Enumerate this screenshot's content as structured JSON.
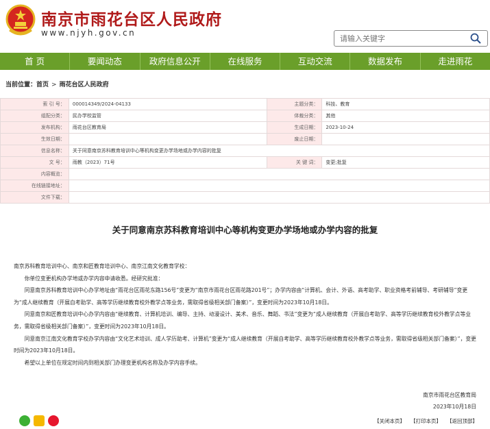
{
  "header": {
    "site_title": "南京市雨花台区人民政府",
    "site_url": "www.njyh.gov.cn",
    "search_placeholder": "请输入关键字"
  },
  "nav": [
    "首 页",
    "要闻动态",
    "政府信息公开",
    "在线服务",
    "互动交流",
    "数据发布",
    "走进雨花"
  ],
  "breadcrumb": {
    "label": "当前位置：",
    "home": "首页",
    "sep": ">",
    "current": "雨花台区人民政府"
  },
  "meta": {
    "rows": [
      {
        "l1": "索 引 号：",
        "v1": "000014349/2024-04133",
        "l2": "主题分类：",
        "v2": "科技、教育"
      },
      {
        "l1": "组配分类：",
        "v1": "民办学校监管",
        "l2": "体裁分类：",
        "v2": "其他"
      },
      {
        "l1": "发布机构：",
        "v1": "雨花台区教育局",
        "l2": "生成日期：",
        "v2": "2023-10-24"
      },
      {
        "l1": "生效日期：",
        "v1": "",
        "l2": "废止日期：",
        "v2": ""
      },
      {
        "l1": "信息名称：",
        "v1": "关于同意南京苏科教育培训中心等机构变更办学场地或办学内容的批复",
        "full": true
      },
      {
        "l1": "文 号：",
        "v1": "雨教（2023）71号",
        "l2": "关 键 词：",
        "v2": "变更;批复"
      },
      {
        "l1": "内容概览：",
        "v1": "",
        "full": true
      },
      {
        "l1": "在线链接地址：",
        "v1": "",
        "full": true
      },
      {
        "l1": "文件下载：",
        "v1": "",
        "full": true
      }
    ]
  },
  "doc": {
    "title": "关于同意南京苏科教育培训中心等机构变更办学场地或办学内容的批复",
    "paragraphs": [
      {
        "text": "南京苏科教育培训中心、南京和匠教育培训中心、南京江南文化教育学校：",
        "indent": false
      },
      {
        "text": "你单位变更机构办学地或办学内容申请收悉。经研究批准：",
        "indent": true
      },
      {
        "text": "同意南京苏科教育培训中心办学地址由“雨花台区雨花东路156号”变更为“南京市雨花台区雨花路201号”；办学内容由“计算机、会计、外语、高考助学、职业资格考前辅导、考研辅导”变更为“成人继续教育（开展自考助学、高等学历继续教育校外教学点等业务，需取得省级相关部门备案）”，变更时间为2023年10月18日。",
        "indent": true
      },
      {
        "text": "同意南京和匠教育培训中心办学内容由“继续教育、计算机培训、编导、主持、动漫设计、美术、音乐、舞蹈、书法”变更为“成人继续教育（开展自考助学、高等学历继续教育校外教学点等业务，需取得省级相关部门备案）”，变更时间为2023年10月18日。",
        "indent": true
      },
      {
        "text": "同意南京江南文化教育学校办学内容由“文化艺术培训、成人学历助考、计算机”变更为“成人继续教育（开展自考助学、高等学历继续教育校外教学点等业务，需取得省级相关部门备案）”，变更时间为2023年10月18日。",
        "indent": true
      },
      {
        "text": "希望以上单位在规定时间内到相关部门办理变更机构名称及办学内容手续。",
        "indent": true
      }
    ],
    "signer": "南京市雨花台区教育局",
    "date": "2023年10月18日"
  },
  "tools": [
    "【关闭本页】",
    "【打印本页】",
    "【返回顶部】"
  ],
  "share_icons": [
    "wechat-icon",
    "qzone-icon",
    "weibo-icon"
  ],
  "colors": {
    "brand_red": "#b01a1a",
    "nav_green": "#6a9f2a",
    "label_pink": "#fde9e9"
  }
}
